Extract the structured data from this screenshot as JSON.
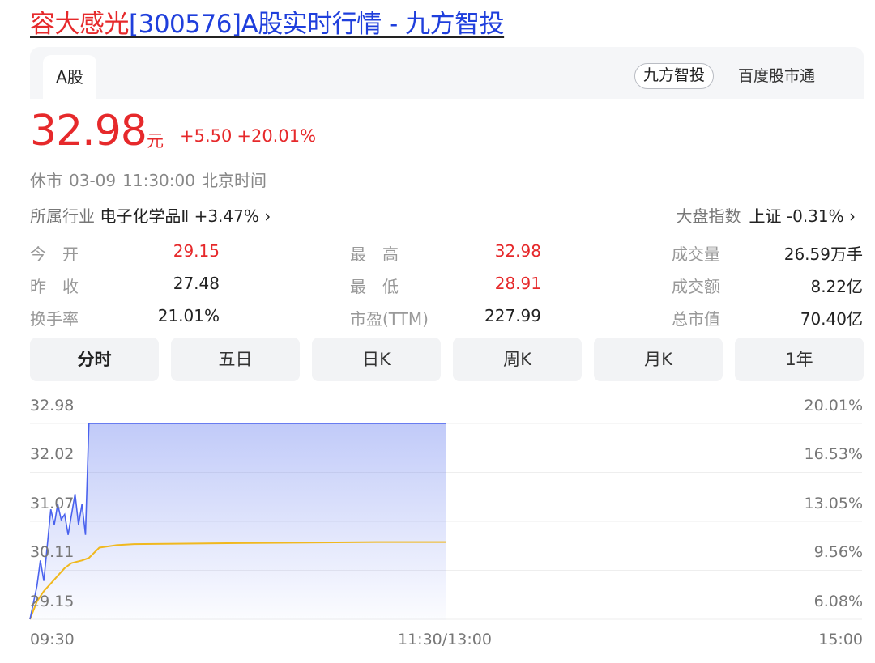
{
  "page": {
    "title_name": "容大感光",
    "title_rest": "[300576]A股实时行情 - 九方智投"
  },
  "tabs": {
    "market_tab": "A股",
    "source_primary": "九方智投",
    "source_secondary": "百度股市通"
  },
  "quote": {
    "price": "32.98",
    "unit": "元",
    "change": "+5.50",
    "change_pct": "+20.01%",
    "status": "休市",
    "date": "03-09",
    "time": "11:30:00",
    "timezone": "北京时间"
  },
  "industry": {
    "label": "所属行业",
    "name": "电子化学品Ⅱ",
    "change": "+3.47%",
    "arrow": "›"
  },
  "market_index": {
    "label": "大盘指数",
    "name": "上证",
    "change": "-0.31%",
    "arrow": "›"
  },
  "stats": {
    "open_label": "今　开",
    "open": "29.15",
    "high_label": "最　高",
    "high": "32.98",
    "volume_label": "成交量",
    "volume": "26.59万手",
    "prev_close_label": "昨　收",
    "prev_close": "27.48",
    "low_label": "最　低",
    "low": "28.91",
    "amount_label": "成交额",
    "amount": "8.22亿",
    "turnover_label": "换手率",
    "turnover": "21.01%",
    "pe_label": "市盈(TTM)",
    "pe": "227.99",
    "mktcap_label": "总市值",
    "mktcap": "70.40亿"
  },
  "period_tabs": [
    "分时",
    "五日",
    "日K",
    "周K",
    "月K",
    "1年"
  ],
  "colors": {
    "up": "#e6292b",
    "price_line": "#4a62ee",
    "avg_line": "#f0b81e",
    "link": "#1f3fdc"
  },
  "chart_data": {
    "type": "line",
    "title": "",
    "x_labels": [
      "09:30",
      "11:30/13:00",
      "15:00"
    ],
    "y_left_ticks": [
      "32.98",
      "32.02",
      "31.07",
      "30.11",
      "29.15"
    ],
    "y_right_ticks": [
      "20.01%",
      "16.53%",
      "13.05%",
      "9.56%",
      "6.08%"
    ],
    "ylim": [
      29.15,
      32.98
    ],
    "session_minutes": 240,
    "series": [
      {
        "key": "price",
        "x": [
          0,
          2,
          3,
          4,
          5,
          6,
          7,
          8,
          9,
          10,
          11,
          12,
          13,
          14,
          15,
          16,
          17,
          18,
          120
        ],
        "values": [
          29.15,
          29.8,
          30.3,
          29.9,
          30.6,
          31.3,
          31.0,
          31.4,
          31.1,
          31.2,
          30.8,
          31.2,
          31.6,
          31.0,
          31.4,
          30.8,
          32.98,
          32.98,
          32.98
        ]
      },
      {
        "key": "avg",
        "x": [
          0,
          2,
          4,
          6,
          8,
          10,
          12,
          15,
          17,
          20,
          25,
          30,
          60,
          100,
          120
        ],
        "values": [
          29.15,
          29.5,
          29.7,
          29.85,
          30.0,
          30.15,
          30.25,
          30.3,
          30.35,
          30.55,
          30.6,
          30.62,
          30.64,
          30.66,
          30.66
        ]
      }
    ]
  }
}
